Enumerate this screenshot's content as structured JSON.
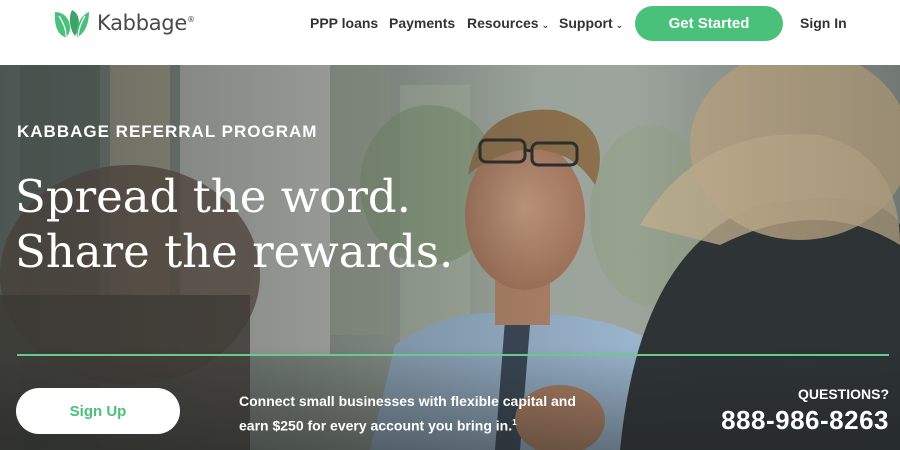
{
  "brand": {
    "name": "Kabbage",
    "registered_mark": "®",
    "accent_color": "#4ac17a"
  },
  "nav": {
    "links": [
      {
        "label": "PPP loans",
        "dropdown": false
      },
      {
        "label": "Payments",
        "dropdown": false
      },
      {
        "label": "Resources",
        "dropdown": true
      },
      {
        "label": "Support",
        "dropdown": true
      }
    ],
    "cta_label": "Get Started",
    "signin_label": "Sign In"
  },
  "hero": {
    "eyebrow": "KABBAGE REFERRAL PROGRAM",
    "headline_line1": "Spread the word.",
    "headline_line2": "Share the rewards.",
    "signup_label": "Sign Up",
    "blurb_line1": "Connect small businesses with flexible capital and",
    "blurb_line2": "earn $250 for every account you bring in.",
    "blurb_footnote": "1",
    "questions_label": "QUESTIONS?",
    "phone": "888-986-8263",
    "divider_color": "#6cc98c"
  }
}
